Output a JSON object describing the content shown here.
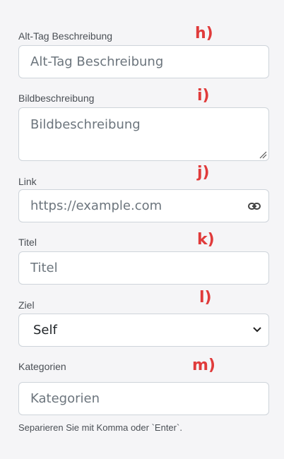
{
  "fields": [
    {
      "label": "Alt-Tag Beschreibung",
      "marker": "h)",
      "placeholder": "Alt-Tag Beschreibung"
    },
    {
      "label": "Bildbeschreibung",
      "marker": "i)",
      "placeholder": "Bildbeschreibung"
    },
    {
      "label": "Link",
      "marker": "j)",
      "placeholder": "https://example.com",
      "icon": "link-icon"
    },
    {
      "label": "Titel",
      "marker": "k)",
      "placeholder": "Titel"
    },
    {
      "label": "Ziel",
      "marker": "l)",
      "selected": "Self",
      "icon": "chevron-down-icon"
    },
    {
      "label": "Kategorien",
      "marker": "m)",
      "placeholder": "Kategorien",
      "help": "Separieren Sie mit Komma oder `Enter`."
    }
  ]
}
